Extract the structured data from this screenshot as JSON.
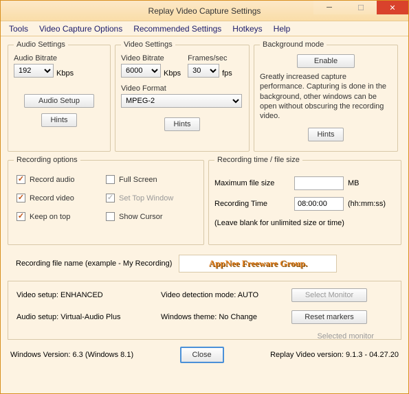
{
  "window": {
    "title": "Replay Video Capture Settings"
  },
  "menu": {
    "tools": "Tools",
    "vco": "Video Capture Options",
    "rec": "Recommended Settings",
    "hotkeys": "Hotkeys",
    "help": "Help"
  },
  "audio": {
    "legend": "Audio Settings",
    "bitrate_label": "Audio Bitrate",
    "bitrate_value": "192",
    "bitrate_unit": "Kbps",
    "setup_btn": "Audio Setup",
    "hints": "Hints"
  },
  "video": {
    "legend": "Video Settings",
    "bitrate_label": "Video Bitrate",
    "bitrate_value": "6000",
    "bitrate_unit": "Kbps",
    "fps_label": "Frames/sec",
    "fps_value": "30",
    "fps_unit": "fps",
    "format_label": "Video Format",
    "format_value": "MPEG-2",
    "hints": "Hints"
  },
  "bg": {
    "legend": "Background mode",
    "enable": "Enable",
    "desc": "Greatly increased capture performance. Capturing is done in the background, other windows can be open without obscuring the recording video.",
    "hints": "Hints"
  },
  "recopt": {
    "legend": "Recording options",
    "record_audio": "Record audio",
    "full_screen": "Full Screen",
    "record_video": "Record video",
    "set_top": "Set Top Window",
    "keep_top": "Keep on top",
    "show_cursor": "Show Cursor"
  },
  "rectime": {
    "legend": "Recording time / file size",
    "maxsize_label": "Maximum file size",
    "maxsize_value": "",
    "maxsize_unit": "MB",
    "time_label": "Recording Time",
    "time_value": "08:00:00",
    "time_unit": "(hh:mm:ss)",
    "note": "(Leave blank for unlimited size or time)"
  },
  "filename": {
    "label": "Recording file name (example -  My Recording)",
    "watermark": "AppNee Freeware Group."
  },
  "status": {
    "video_setup": "Video setup: ENHANCED",
    "detection": "Video detection mode: AUTO",
    "audio_setup": "Audio setup: Virtual-Audio Plus",
    "theme": "Windows theme: No Change",
    "select_monitor": "Select Monitor",
    "reset_markers": "Reset markers",
    "selected_monitor": "Selected monitor"
  },
  "footer": {
    "win_ver": "Windows Version: 6.3 (Windows 8.1)",
    "close": "Close",
    "app_ver": "Replay Video version: 9.1.3 - 04.27.20"
  }
}
